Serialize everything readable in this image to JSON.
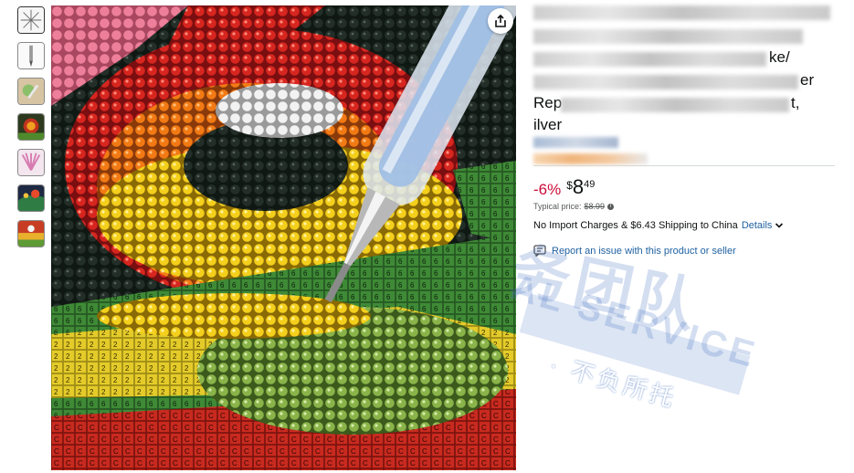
{
  "thumbnails": [
    {
      "name": "thumb-starburst"
    },
    {
      "name": "thumb-pen"
    },
    {
      "name": "thumb-craft"
    },
    {
      "name": "thumb-rose"
    },
    {
      "name": "thumb-pink-fan"
    },
    {
      "name": "thumb-painting"
    },
    {
      "name": "thumb-closeup"
    }
  ],
  "product": {
    "title_visible_fragments": [
      "ke/",
      "er",
      "Rep",
      "t,",
      "ilver"
    ],
    "price": {
      "discount": "-6%",
      "currency": "$",
      "whole": "8",
      "fraction": "49"
    },
    "typical_price_label": "Typical price:",
    "typical_price_value": "$8.99",
    "shipping_text": "No Import Charges & $6.43 Shipping to China",
    "shipping_details_link": "Details",
    "report_link": "Report an issue with this product or seller"
  },
  "watermark": {
    "chinese_main": "务团队",
    "latin": "AL SERVICE",
    "tagline": "· 不负所托"
  },
  "colors": {
    "discount": "#cc0c39",
    "link": "#2162a1",
    "text": "#0f1111",
    "muted": "#565959",
    "watermark": "#3f6fc2"
  }
}
